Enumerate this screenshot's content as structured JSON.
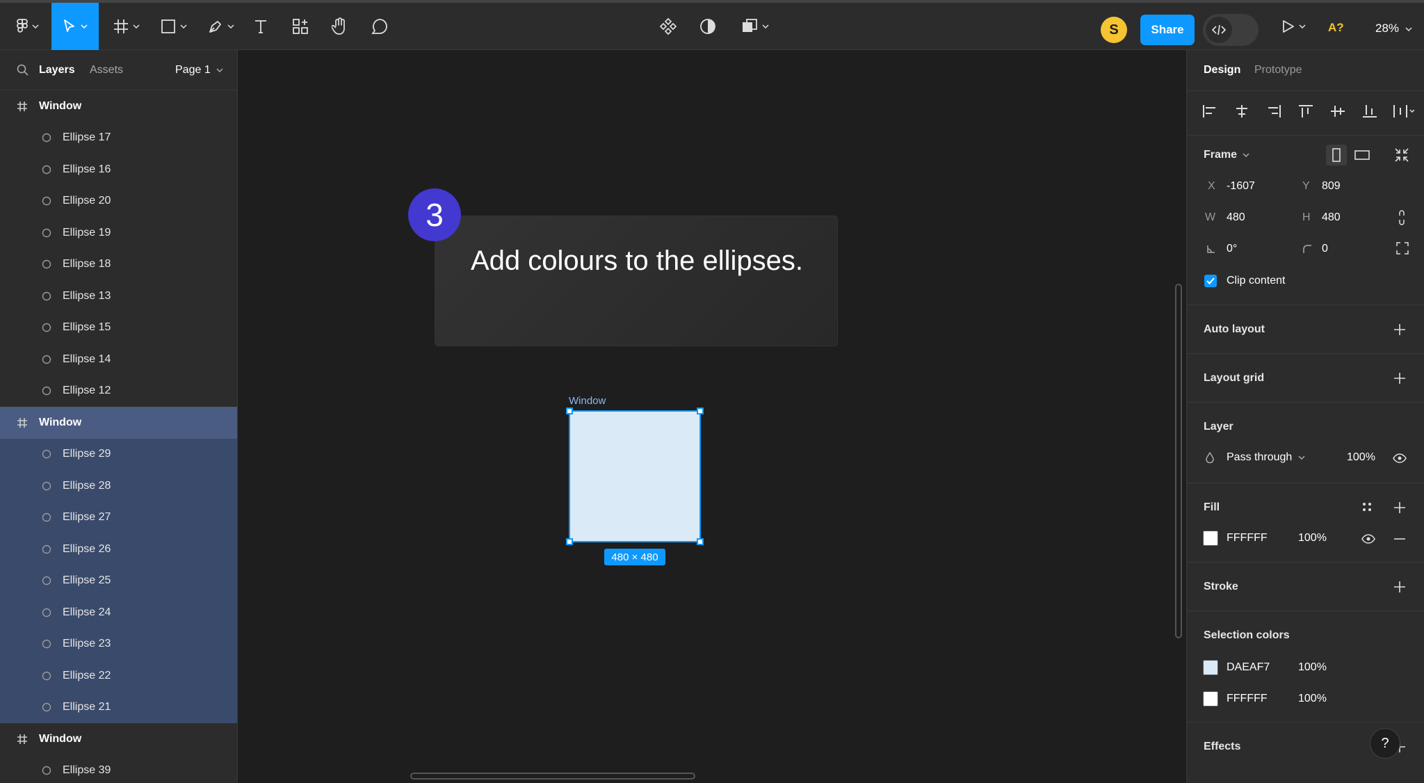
{
  "toolbar": {
    "share_label": "Share",
    "avatar_initial": "S",
    "a11y_badge": "A?",
    "zoom": "28%"
  },
  "left_panel": {
    "tab_layers": "Layers",
    "tab_assets": "Assets",
    "page": "Page 1",
    "layers": [
      {
        "label": "Window",
        "kind": "frame",
        "selected": false
      },
      {
        "label": "Ellipse 17",
        "kind": "ellipse",
        "selected": false
      },
      {
        "label": "Ellipse 16",
        "kind": "ellipse",
        "selected": false
      },
      {
        "label": "Ellipse 20",
        "kind": "ellipse",
        "selected": false
      },
      {
        "label": "Ellipse 19",
        "kind": "ellipse",
        "selected": false
      },
      {
        "label": "Ellipse 18",
        "kind": "ellipse",
        "selected": false
      },
      {
        "label": "Ellipse 13",
        "kind": "ellipse",
        "selected": false
      },
      {
        "label": "Ellipse 15",
        "kind": "ellipse",
        "selected": false
      },
      {
        "label": "Ellipse 14",
        "kind": "ellipse",
        "selected": false
      },
      {
        "label": "Ellipse 12",
        "kind": "ellipse",
        "selected": false
      },
      {
        "label": "Window",
        "kind": "frame",
        "selected": true
      },
      {
        "label": "Ellipse 29",
        "kind": "ellipse",
        "selected": true
      },
      {
        "label": "Ellipse 28",
        "kind": "ellipse",
        "selected": true
      },
      {
        "label": "Ellipse 27",
        "kind": "ellipse",
        "selected": true
      },
      {
        "label": "Ellipse 26",
        "kind": "ellipse",
        "selected": true
      },
      {
        "label": "Ellipse 25",
        "kind": "ellipse",
        "selected": true
      },
      {
        "label": "Ellipse 24",
        "kind": "ellipse",
        "selected": true
      },
      {
        "label": "Ellipse 23",
        "kind": "ellipse",
        "selected": true
      },
      {
        "label": "Ellipse 22",
        "kind": "ellipse",
        "selected": true
      },
      {
        "label": "Ellipse 21",
        "kind": "ellipse",
        "selected": true
      },
      {
        "label": "Window",
        "kind": "frame",
        "selected": false
      },
      {
        "label": "Ellipse 39",
        "kind": "ellipse",
        "selected": false
      }
    ]
  },
  "canvas": {
    "step_number": "3",
    "instruction": "Add colours to the ellipses.",
    "frame_label": "Window",
    "size_tag": "480 × 480"
  },
  "right_panel": {
    "tab_design": "Design",
    "tab_prototype": "Prototype",
    "frame_title": "Frame",
    "x_label": "X",
    "x_value": "-1607",
    "y_label": "Y",
    "y_value": "809",
    "w_label": "W",
    "w_value": "480",
    "h_label": "H",
    "h_value": "480",
    "rotation": "0°",
    "radius": "0",
    "clip_content": "Clip content",
    "auto_layout": "Auto layout",
    "layout_grid": "Layout grid",
    "layer_title": "Layer",
    "blend_mode": "Pass through",
    "layer_opacity": "100%",
    "fill_title": "Fill",
    "fill_hex": "FFFFFF",
    "fill_opacity": "100%",
    "stroke_title": "Stroke",
    "selection_colors_title": "Selection colors",
    "selection_colors": [
      {
        "hex": "DAEAF7",
        "opacity": "100%",
        "color": "#daeaf7"
      },
      {
        "hex": "FFFFFF",
        "opacity": "100%",
        "color": "#ffffff"
      }
    ],
    "effects_title": "Effects",
    "help": "?"
  },
  "colors": {
    "accent": "#0d99ff",
    "step_badge": "#4338d0",
    "frame_fill": "#daeaf7",
    "avatar": "#f5c430"
  }
}
